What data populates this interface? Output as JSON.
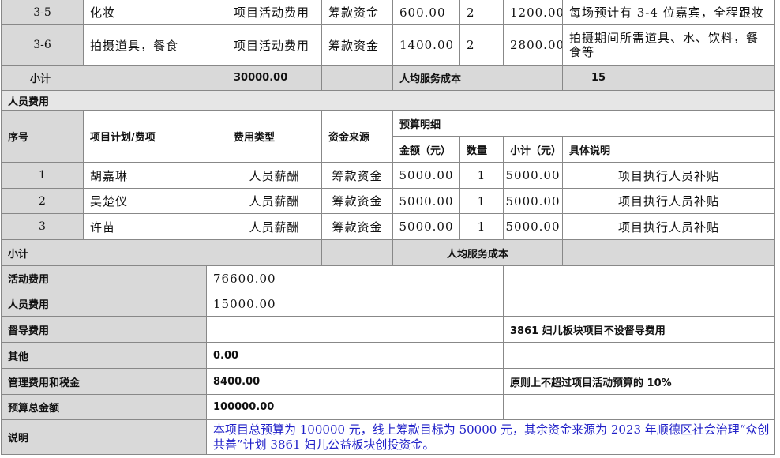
{
  "table": {
    "row_35": {
      "no": "3-5",
      "item": "化妆",
      "type": "项目活动费用",
      "source": "筹款资金",
      "amount": "600.00",
      "qty": "2",
      "subtotal": "1200.00",
      "note": "每场预计有 3-4 位嘉宾，全程跟妆"
    },
    "row_36": {
      "no": "3-6",
      "item": "拍摄道具，餐食",
      "type": "项目活动费用",
      "source": "筹款资金",
      "amount": "1400.00",
      "qty": "2",
      "subtotal": "2800.00",
      "note": "拍摄期间所需道具、水、饮料，餐食等"
    },
    "activity_subtotal": {
      "label": "小计",
      "total": "30000.00",
      "per_capita_label": "人均服务成本",
      "per_capita_value": "15"
    },
    "personnel_section_title": "人员费用",
    "headers": {
      "no": "序号",
      "item": "项目计划/费项",
      "type": "费用类型",
      "source": "资金来源",
      "budget_detail": "预算明细",
      "amount": "金额（元）",
      "qty": "数量",
      "subtotal": "小计（元）",
      "note": "具体说明"
    },
    "personnel_rows": [
      {
        "no": "1",
        "item": "胡嘉琳",
        "type": "人员薪酬",
        "source": "筹款资金",
        "amount": "5000.00",
        "qty": "1",
        "subtotal": "5000.00",
        "note": "项目执行人员补贴"
      },
      {
        "no": "2",
        "item": "吴楚仪",
        "type": "人员薪酬",
        "source": "筹款资金",
        "amount": "5000.00",
        "qty": "1",
        "subtotal": "5000.00",
        "note": "项目执行人员补贴"
      },
      {
        "no": "3",
        "item": "许苗",
        "type": "人员薪酬",
        "source": "筹款资金",
        "amount": "5000.00",
        "qty": "1",
        "subtotal": "5000.00",
        "note": "项目执行人员补贴"
      }
    ],
    "personnel_subtotal": {
      "label": "小计",
      "per_capita_label": "人均服务成本"
    },
    "summary": [
      {
        "label": "活动费用",
        "value": "76600.00",
        "note": ""
      },
      {
        "label": "人员费用",
        "value": "15000.00",
        "note": ""
      },
      {
        "label": "督导费用",
        "value": "",
        "note": "3861 妇儿板块项目不设督导费用"
      },
      {
        "label": "其他",
        "value": "0.00",
        "note": ""
      },
      {
        "label": "管理费用和税金",
        "value": "8400.00",
        "note": "原则上不超过项目活动预算的 10%"
      },
      {
        "label": "预算总金额",
        "value": "100000.00",
        "note": ""
      }
    ],
    "explanation": {
      "label": "说明",
      "text": "本项目总预算为 100000 元，线上筹款目标为 50000 元，其余资金来源为 2023 年顺德区社会治理“众创共善”计划 3861 妇儿公益板块创投资金。"
    }
  }
}
